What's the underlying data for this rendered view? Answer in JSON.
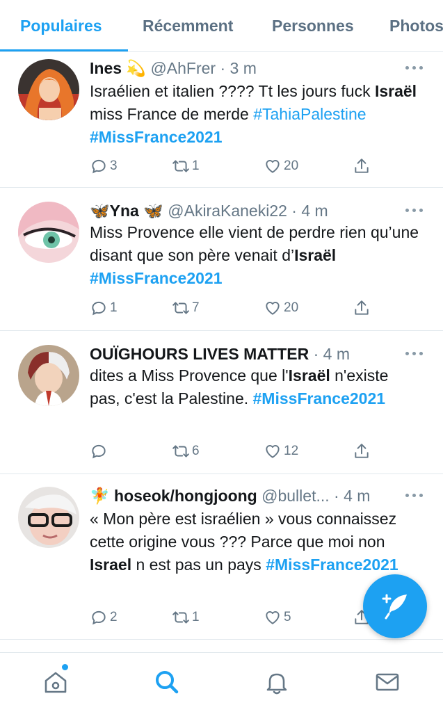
{
  "tabs": [
    {
      "label": "Populaires",
      "active": true
    },
    {
      "label": "Récemment",
      "active": false
    },
    {
      "label": "Personnes",
      "active": false
    },
    {
      "label": "Photos",
      "active": false
    }
  ],
  "tweets": [
    {
      "name": "Ines",
      "name_emoji": "💫",
      "handle": "@AhFrer",
      "time": "3 m",
      "text": [
        {
          "t": "Israélien et italien ???? Tt les jours fuck ",
          "s": ""
        },
        {
          "t": "Israël",
          "s": "b"
        },
        {
          "t": " miss France de merde ",
          "s": ""
        },
        {
          "t": "#TahiaPalestine",
          "s": "tag"
        },
        {
          "t": " ",
          "s": ""
        },
        {
          "t": "#MissFrance2021",
          "s": "tagb"
        }
      ],
      "replies": "3",
      "retweets": "1",
      "likes": "20"
    },
    {
      "name": "Yna",
      "name_emoji_before": "🦋",
      "name_emoji_after": "🦋",
      "handle": "@AkiraKaneki22",
      "time": "4 m",
      "text": [
        {
          "t": "Miss Provence elle vient de perdre rien qu’une disant que son père venait d’",
          "s": ""
        },
        {
          "t": "Israël",
          "s": "b"
        },
        {
          "t": "  ",
          "s": ""
        },
        {
          "t": "#MissFrance2021",
          "s": "tagb"
        }
      ],
      "replies": "1",
      "retweets": "7",
      "likes": "20"
    },
    {
      "name": "OUÏGHOURS LIVES MATTER",
      "handle": "",
      "time": "4 m",
      "text": [
        {
          "t": "dites a Miss Provence que l'",
          "s": ""
        },
        {
          "t": "Israël",
          "s": "b"
        },
        {
          "t": " n'existe pas, c'est la Palestine. ",
          "s": ""
        },
        {
          "t": "#MissFrance2021",
          "s": "tagb"
        }
      ],
      "replies": "",
      "retweets": "6",
      "likes": "12"
    },
    {
      "name": "hoseok/hongjoong",
      "name_emoji_before": "🧚",
      "handle": "@bullet...",
      "time": "4 m",
      "text": [
        {
          "t": "« Mon père est israélien » vous connaissez cette origine vous ??? Parce que moi non ",
          "s": ""
        },
        {
          "t": "Israel",
          "s": "b"
        },
        {
          "t": " n est pas un pays ",
          "s": ""
        },
        {
          "t": "#MissFrance2021",
          "s": "tagb"
        }
      ],
      "replies": "2",
      "retweets": "1",
      "likes": "5"
    }
  ],
  "icons": {
    "reply": "reply-icon",
    "retweet": "retweet-icon",
    "like": "heart-icon",
    "share": "share-icon",
    "compose": "compose-tweet-icon",
    "home": "home-icon",
    "search": "search-icon",
    "notifications": "bell-icon",
    "messages": "mail-icon"
  },
  "colors": {
    "accent": "#1da1f2",
    "secondary_text": "#657786",
    "divider": "#e1e8ed"
  }
}
